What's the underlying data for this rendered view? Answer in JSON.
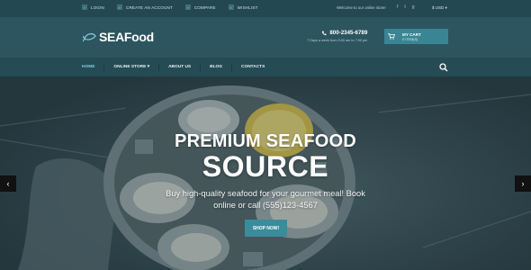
{
  "topbar": {
    "links": [
      {
        "icon": "login-icon",
        "label": "LOGIN"
      },
      {
        "icon": "create-account-icon",
        "label": "CREATE AN ACCOUNT"
      },
      {
        "icon": "compare-icon",
        "label": "COMPARE"
      },
      {
        "icon": "wishlist-icon",
        "label": "WISHLIST"
      }
    ],
    "welcome": "Welcome to our online store!",
    "currency": "$ USD"
  },
  "header": {
    "logo": "SEAFood",
    "phone": "800-2345-6789",
    "hours": "7 Days a week from 9:00 am to 7:00 pm",
    "cart_title": "MY CART",
    "cart_items": "0 ITEM(S)"
  },
  "nav": {
    "items": [
      "HOME",
      "ONLINE STORE",
      "ABOUT US",
      "BLOG",
      "CONTACTS"
    ]
  },
  "hero": {
    "title1": "PREMIUM SEAFOOD",
    "title2": "SOURCE",
    "subtitle": "Buy high-quality seafood for your gourmet meal! Book online or call (555)123-4567",
    "cta": "SHOP NOW!"
  },
  "colors": {
    "topbar": "#244852",
    "header": "#2c5560",
    "nav": "#254b55",
    "accent": "#3b8c9b"
  }
}
